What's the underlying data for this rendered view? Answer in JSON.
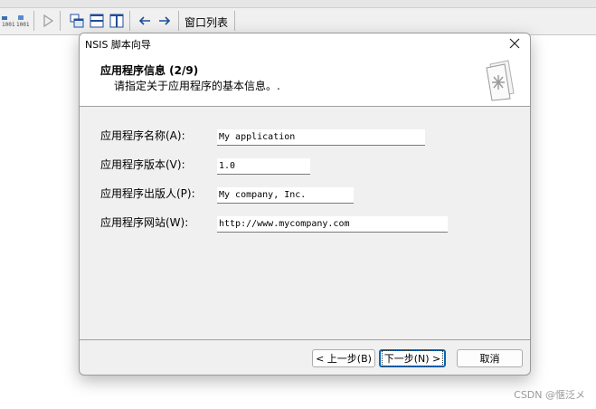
{
  "toolbar": {
    "window_list_label": "窗口列表",
    "icons": [
      "compile-icon",
      "compile-run-icon",
      "run-icon",
      "tile-cascade-icon",
      "tile-horizontal-icon",
      "tile-vertical-icon",
      "back-icon",
      "forward-icon"
    ]
  },
  "dialog": {
    "title": "NSIS 脚本向导",
    "header_title": "应用程序信息 (2/9)",
    "header_subtitle": "请指定关于应用程序的基本信息。.",
    "fields": [
      {
        "label": "应用程序名称(A):",
        "value": "My application"
      },
      {
        "label": "应用程序版本(V):",
        "value": "1.0"
      },
      {
        "label": "应用程序出版人(P):",
        "value": "My company, Inc."
      },
      {
        "label": "应用程序网站(W):",
        "value": "http://www.mycompany.com"
      }
    ],
    "buttons": {
      "back": "< 上一步(B)",
      "next": "下一步(N) >",
      "cancel": "取消"
    }
  },
  "watermark": "CSDN @惬泛メ",
  "colors": {
    "dialog_bg": "#f0f0f0",
    "header_bg": "#ffffff",
    "default_button_border": "#0067c0"
  }
}
